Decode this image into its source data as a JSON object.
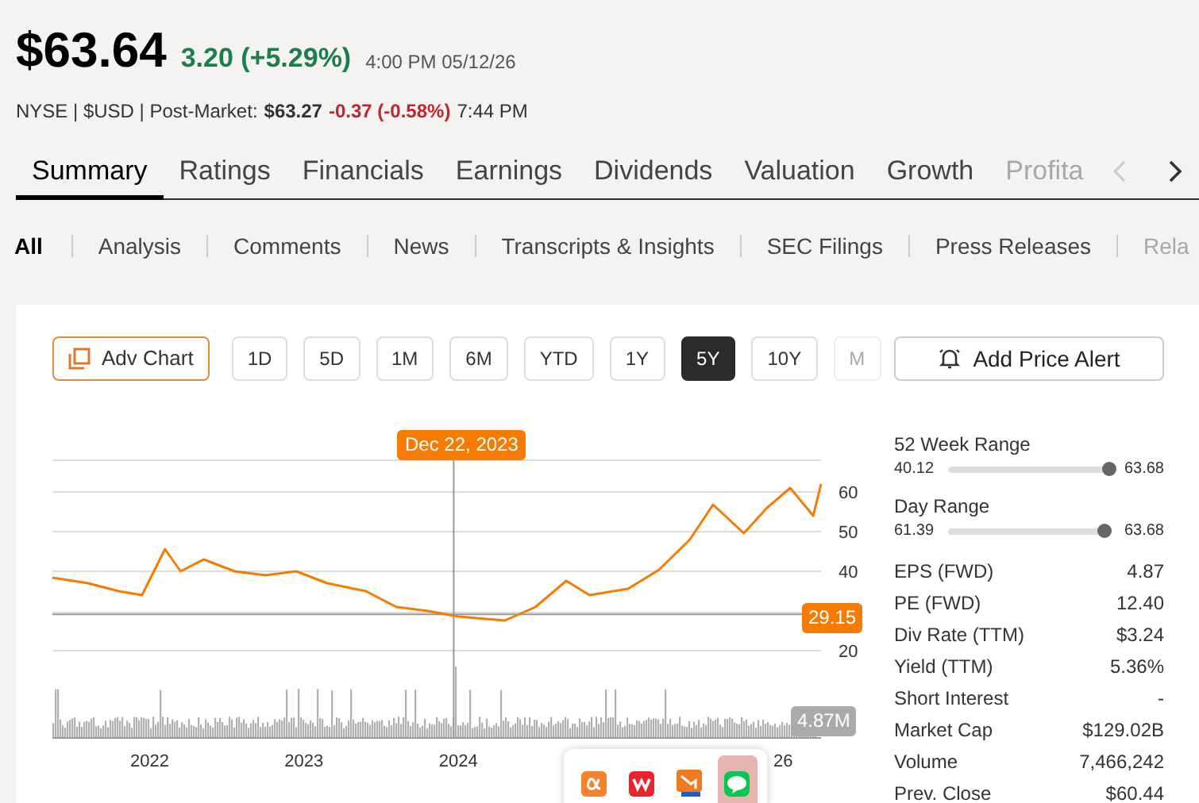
{
  "quote": {
    "price": "$63.64",
    "change": "3.20 (+5.29%)",
    "time": "4:00 PM 05/12/26",
    "exchange_line": "NYSE | $USD | Post-Market:",
    "post_price": "$63.27",
    "post_change": "-0.37 (-0.58%)",
    "post_time": "7:44 PM"
  },
  "tabs": [
    {
      "label": "Summary",
      "selected": true,
      "faded": false
    },
    {
      "label": "Ratings",
      "selected": false,
      "faded": false
    },
    {
      "label": "Financials",
      "selected": false,
      "faded": false
    },
    {
      "label": "Earnings",
      "selected": false,
      "faded": false
    },
    {
      "label": "Dividends",
      "selected": false,
      "faded": false
    },
    {
      "label": "Valuation",
      "selected": false,
      "faded": false
    },
    {
      "label": "Growth",
      "selected": false,
      "faded": false
    },
    {
      "label": "Profita",
      "selected": false,
      "faded": true
    }
  ],
  "tab_scroll": {
    "prev_disabled": true,
    "next_disabled": false
  },
  "subtabs": [
    {
      "label": "All",
      "selected": true,
      "faded": false
    },
    {
      "label": "Analysis",
      "selected": false,
      "faded": false
    },
    {
      "label": "Comments",
      "selected": false,
      "faded": false
    },
    {
      "label": "News",
      "selected": false,
      "faded": false
    },
    {
      "label": "Transcripts & Insights",
      "selected": false,
      "faded": false
    },
    {
      "label": "SEC Filings",
      "selected": false,
      "faded": false
    },
    {
      "label": "Press Releases",
      "selected": false,
      "faded": false
    },
    {
      "label": "Rela",
      "selected": false,
      "faded": true
    }
  ],
  "adv_chart": "Adv Chart",
  "ranges": [
    {
      "label": "1D",
      "selected": false,
      "faded": false
    },
    {
      "label": "5D",
      "selected": false,
      "faded": false
    },
    {
      "label": "1M",
      "selected": false,
      "faded": false
    },
    {
      "label": "6M",
      "selected": false,
      "faded": false
    },
    {
      "label": "YTD",
      "selected": false,
      "faded": false
    },
    {
      "label": "1Y",
      "selected": false,
      "faded": false
    },
    {
      "label": "5Y",
      "selected": true,
      "faded": false
    },
    {
      "label": "10Y",
      "selected": false,
      "faded": false
    },
    {
      "label": "M",
      "selected": false,
      "faded": true
    }
  ],
  "chart": {
    "crosshair_date": "Dec 22, 2023",
    "crosshair_value": "29.15",
    "volume_label": "4.87M",
    "covered_tick_label": "26",
    "chart_data": {
      "type": "line",
      "xlim": [
        2021.37,
        2026.35
      ],
      "ylim": [
        20,
        68
      ],
      "grid": true,
      "ref_lines": [
        {
          "axis": "x",
          "value": 2023.97
        },
        {
          "axis": "y",
          "value": 29.15
        }
      ],
      "xticks": [
        {
          "value": 2022,
          "label": "2022"
        },
        {
          "value": 2023,
          "label": "2023"
        },
        {
          "value": 2024,
          "label": "2024"
        }
      ],
      "yticks": [
        20,
        40,
        50,
        60
      ],
      "x": [
        2021.37,
        2021.6,
        2021.8,
        2021.95,
        2022.1,
        2022.2,
        2022.35,
        2022.55,
        2022.75,
        2022.95,
        2023.15,
        2023.4,
        2023.6,
        2023.8,
        2024.0,
        2024.3,
        2024.5,
        2024.7,
        2024.85,
        2025.1,
        2025.3,
        2025.5,
        2025.65,
        2025.85,
        2026.0,
        2026.15,
        2026.3,
        2026.35
      ],
      "series": [
        {
          "color": "#f57c00",
          "values": [
            38.4,
            37,
            35,
            34,
            45.6,
            40,
            43,
            40,
            39,
            40,
            37,
            35,
            31,
            30,
            28.6,
            27.6,
            31,
            37.6,
            34,
            35.6,
            40.4,
            48,
            56.8,
            49.6,
            56,
            61,
            54,
            62
          ]
        }
      ]
    }
  },
  "alert_button": "Add Price Alert",
  "ranges_panel": [
    {
      "title": "52 Week Range",
      "low": "40.12",
      "high": "63.68",
      "level": 0.98
    },
    {
      "title": "Day Range",
      "low": "61.39",
      "high": "63.68",
      "level": 0.95
    }
  ],
  "stats": [
    {
      "label": "EPS (FWD)",
      "value": "4.87"
    },
    {
      "label": "PE (FWD)",
      "value": "12.40"
    },
    {
      "label": "Div Rate (TTM)",
      "value": "$3.24"
    },
    {
      "label": "Yield (TTM)",
      "value": "5.36%"
    },
    {
      "label": "Short Interest",
      "value": "-"
    },
    {
      "label": "Market Cap",
      "value": "$129.02B"
    },
    {
      "label": "Volume",
      "value": "7,466,242"
    },
    {
      "label": "Prev. Close",
      "value": "$60.44"
    }
  ],
  "tray": [
    {
      "kind": "alpha",
      "selected": false
    },
    {
      "kind": "wps",
      "selected": false
    },
    {
      "kind": "tool",
      "selected": false
    },
    {
      "kind": "chat",
      "selected": true
    }
  ]
}
